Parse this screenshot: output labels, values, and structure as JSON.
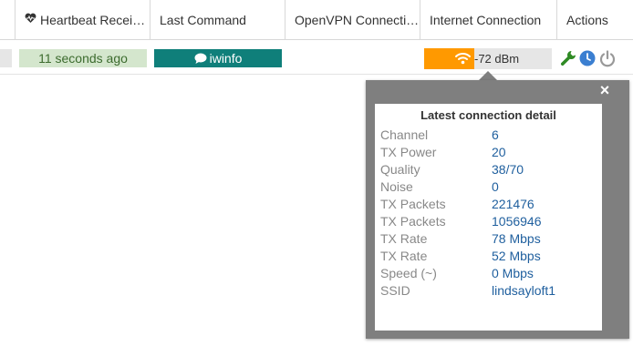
{
  "header": {
    "heartbeat": "Heartbeat Recei…",
    "last_command": "Last Command",
    "openvpn": "OpenVPN Connecti…",
    "internet": "Internet Connection",
    "actions": "Actions"
  },
  "row": {
    "heartbeat": "11 seconds ago",
    "last_command": "iwinfo",
    "signal": "-72 dBm",
    "signal_quality_fraction": 0.39,
    "colors": {
      "heartbeat_bg": "#d4e6cd",
      "command_bg": "#0f7f7a",
      "signal_bar": "#ff9900"
    },
    "actions": [
      "wrench-icon",
      "clock-icon",
      "power-icon"
    ]
  },
  "popover": {
    "close": "×",
    "title": "Latest connection detail",
    "rows": [
      {
        "label": "Channel",
        "value": "6"
      },
      {
        "label": "TX Power",
        "value": "20"
      },
      {
        "label": "Quality",
        "value": "38/70"
      },
      {
        "label": "Noise",
        "value": "0"
      },
      {
        "label": "TX Packets",
        "value": "221476"
      },
      {
        "label": "TX Packets",
        "value": "1056946"
      },
      {
        "label": "TX Rate",
        "value": "78 Mbps"
      },
      {
        "label": "TX Rate",
        "value": "52 Mbps"
      },
      {
        "label": "Speed (~)",
        "value": "0 Mbps"
      },
      {
        "label": "SSID",
        "value": "lindsayloft1"
      }
    ]
  }
}
